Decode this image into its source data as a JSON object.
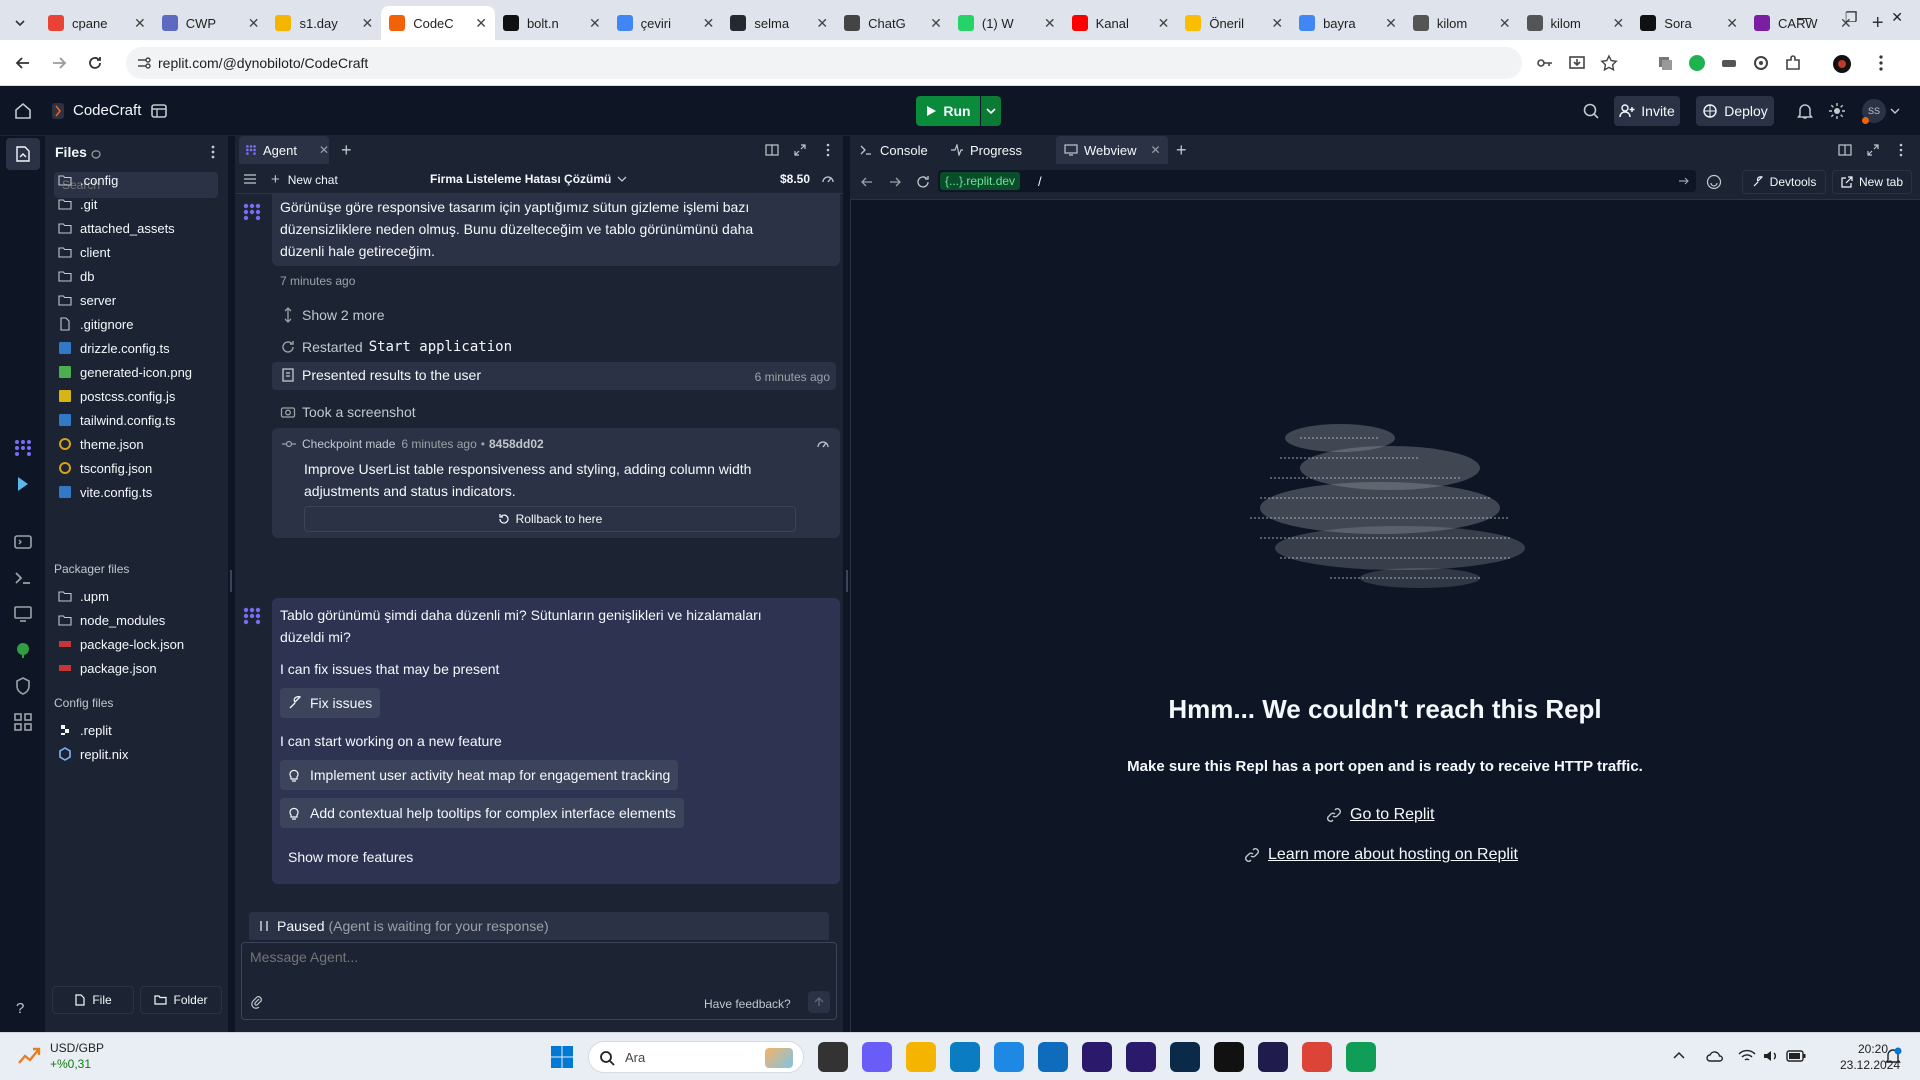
{
  "browser": {
    "tabs": [
      {
        "label": "cpane",
        "color": "#ea4335"
      },
      {
        "label": "CWP",
        "color": "#5c6bc0"
      },
      {
        "label": "s1.day",
        "color": "#f4b400"
      },
      {
        "label": "CodeC",
        "color": "#f26207",
        "active": true
      },
      {
        "label": "bolt.n",
        "color": "#111111"
      },
      {
        "label": "çeviri",
        "color": "#4285f4"
      },
      {
        "label": "selma",
        "color": "#24292f"
      },
      {
        "label": "ChatG",
        "color": "#444444"
      },
      {
        "label": "(1) W",
        "color": "#25d366"
      },
      {
        "label": "Kanal",
        "color": "#ff0000"
      },
      {
        "label": "Öneril",
        "color": "#fbbc04"
      },
      {
        "label": "bayra",
        "color": "#4285f4"
      },
      {
        "label": "kilom",
        "color": "#555555"
      },
      {
        "label": "kilom",
        "color": "#555555"
      },
      {
        "label": "Sora",
        "color": "#111111"
      },
      {
        "label": "CARW",
        "color": "#7b1fa2"
      }
    ],
    "url": "replit.com/@dynobiloto/CodeCraft"
  },
  "header": {
    "project_name": "CodeCraft",
    "run_label": "Run",
    "invite_label": "Invite",
    "deploy_label": "Deploy",
    "avatar_initials": "SS"
  },
  "files": {
    "title": "Files",
    "search_placeholder": "Search",
    "items": [
      {
        "name": ".config",
        "type": "folder"
      },
      {
        "name": ".git",
        "type": "folder"
      },
      {
        "name": "attached_assets",
        "type": "folder"
      },
      {
        "name": "client",
        "type": "folder"
      },
      {
        "name": "db",
        "type": "folder"
      },
      {
        "name": "server",
        "type": "folder"
      },
      {
        "name": ".gitignore",
        "type": "file"
      },
      {
        "name": "drizzle.config.ts",
        "type": "ts"
      },
      {
        "name": "generated-icon.png",
        "type": "png"
      },
      {
        "name": "postcss.config.js",
        "type": "js"
      },
      {
        "name": "tailwind.config.ts",
        "type": "ts"
      },
      {
        "name": "theme.json",
        "type": "json"
      },
      {
        "name": "tsconfig.json",
        "type": "json"
      },
      {
        "name": "vite.config.ts",
        "type": "ts"
      }
    ],
    "packager_title": "Packager files",
    "packager_items": [
      {
        "name": ".upm",
        "type": "folder"
      },
      {
        "name": "node_modules",
        "type": "folder"
      },
      {
        "name": "package-lock.json",
        "type": "npm"
      },
      {
        "name": "package.json",
        "type": "npm"
      }
    ],
    "config_title": "Config files",
    "config_items": [
      {
        "name": ".replit",
        "type": "replit"
      },
      {
        "name": "replit.nix",
        "type": "nix"
      }
    ],
    "file_button": "File",
    "folder_button": "Folder"
  },
  "agent": {
    "tab_label": "Agent",
    "new_chat": "New chat",
    "chat_title": "Firma Listeleme Hatası Çözümü",
    "cost": "$8.50",
    "msg1": "Görünüşe göre responsive tasarım için yaptığımız sütun gizleme işlemi bazı düzensizliklere neden olmuş. Bunu düzelteceğim ve tablo görünümünü daha düzenli hale getireceğim.",
    "msg1_time": "7 minutes ago",
    "show_more": "Show 2 more",
    "restarted_prefix": "Restarted",
    "restarted_code": "Start application",
    "presented": "Presented results to the user",
    "presented_time": "6 minutes ago",
    "screenshot": "Took a screenshot",
    "checkpoint_label": "Checkpoint made",
    "checkpoint_time": "6 minutes ago",
    "checkpoint_hash": "8458dd02",
    "checkpoint_desc": "Improve UserList table responsiveness and styling, adding column width adjustments and status indicators.",
    "rollback": "Rollback to here",
    "msg2": "Tablo görünümü şimdi daha düzenli mi? Sütunların genişlikleri ve hizalamaları düzeldi mi?",
    "fix_prompt": "I can fix issues that may be present",
    "fix_button": "Fix issues",
    "feature_prompt": "I can start working on a new feature",
    "feature1": "Implement user activity heat map for engagement tracking",
    "feature2": "Add contextual help tooltips for complex interface elements",
    "show_more_features": "Show more features",
    "paused": "Paused",
    "paused_detail": "(Agent is waiting for your response)",
    "input_placeholder": "Message Agent...",
    "feedback": "Have feedback?"
  },
  "webview": {
    "tabs": [
      "Console",
      "Progress",
      "Webview"
    ],
    "url_domain": "{...}.replit.dev",
    "url_path": "/",
    "devtools": "Devtools",
    "new_tab": "New tab",
    "error_title": "Hmm... We couldn't reach this Repl",
    "error_subtitle": "Make sure this Repl has a port open and is ready to receive HTTP traffic.",
    "link1": "Go to Replit",
    "link2": "Learn more about hosting on Replit"
  },
  "taskbar": {
    "currency_pair": "USD/GBP",
    "currency_change": "+%0,31",
    "search_label": "Ara",
    "time": "20:20",
    "date": "23.12.2024"
  },
  "colors": {
    "accent": "#0a8a3b",
    "bg": "#0e1525",
    "panel": "#1c2333",
    "surface": "#2b3245"
  }
}
